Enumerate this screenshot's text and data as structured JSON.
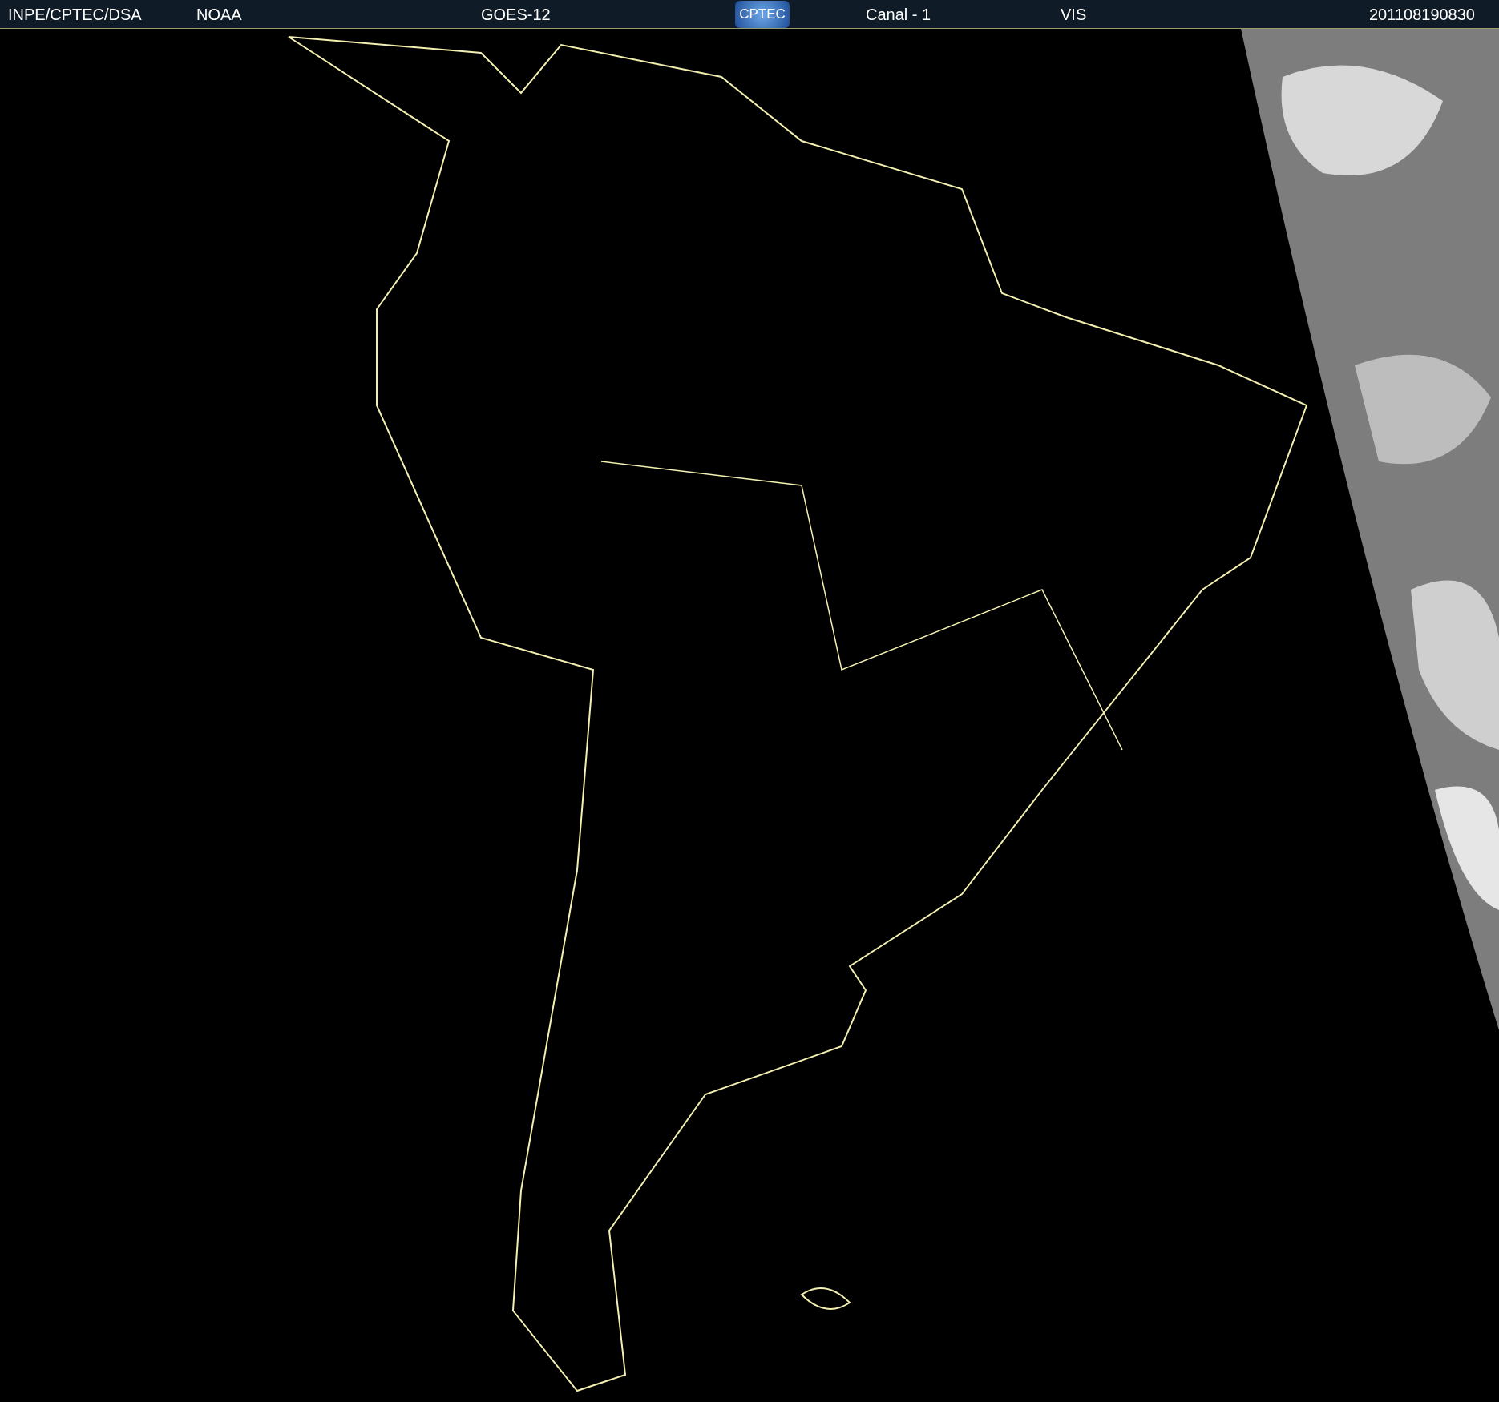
{
  "header": {
    "source": "INPE/CPTEC/DSA",
    "agency": "NOAA",
    "satellite": "GOES-12",
    "logo": "CPTEC",
    "channel": "Canal - 1",
    "band": "VIS",
    "timestamp": "201108190830"
  }
}
